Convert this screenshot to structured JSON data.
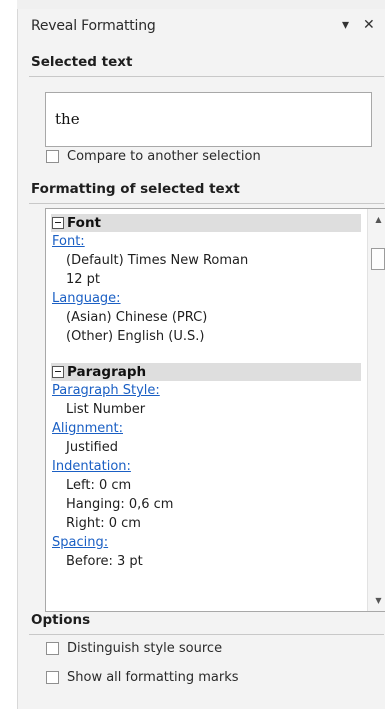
{
  "pane": {
    "title": "Reveal Formatting",
    "dropdown_glyph": "▾",
    "close_glyph": "✕"
  },
  "selected": {
    "heading": "Selected text",
    "text": "the",
    "compare_label": "Compare to another selection"
  },
  "formatting": {
    "heading": "Formatting of selected text",
    "groups": [
      {
        "title": "Font",
        "entries": [
          {
            "label": "Font:",
            "values": [
              "(Default) Times New Roman",
              "12 pt"
            ]
          },
          {
            "label": "Language:",
            "values": [
              "(Asian) Chinese (PRC)",
              "(Other) English (U.S.)"
            ]
          }
        ]
      },
      {
        "title": "Paragraph",
        "entries": [
          {
            "label": "Paragraph Style:",
            "values": [
              "List Number"
            ]
          },
          {
            "label": "Alignment:",
            "values": [
              "Justified"
            ]
          },
          {
            "label": "Indentation:",
            "values": [
              "Left:  0 cm",
              "Hanging:  0,6 cm",
              "Right:  0 cm"
            ]
          },
          {
            "label": "Spacing:",
            "values": [
              "Before:  3 pt"
            ]
          }
        ]
      }
    ]
  },
  "options": {
    "heading": "Options",
    "distinguish_label": "Distinguish style source",
    "show_marks_label": "Show all formatting marks"
  },
  "icons": {
    "scroll_up": "chevron-up-icon",
    "scroll_down": "chevron-down-icon",
    "collapse": "collapse-minus-icon"
  },
  "colors": {
    "link": "#1a5fc4",
    "group_header_bg": "#dedede",
    "pane_bg": "#f3f3f3"
  }
}
